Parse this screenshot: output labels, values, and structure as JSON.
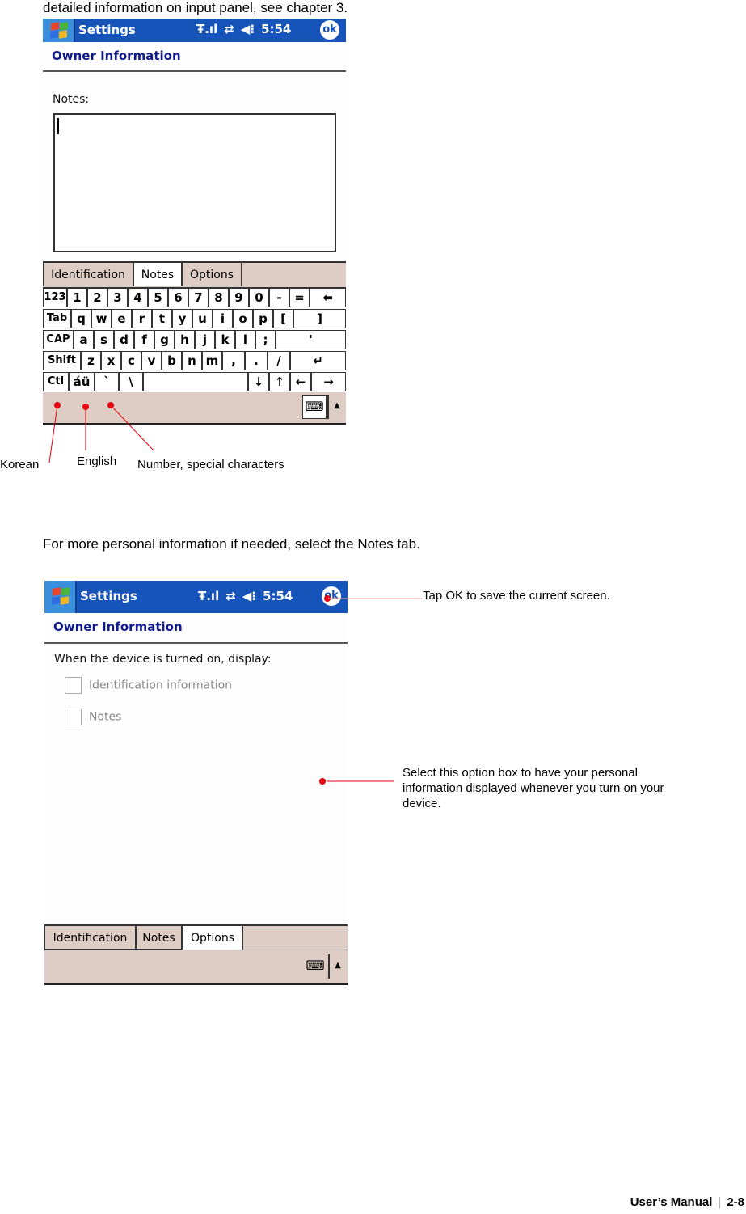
{
  "doc": {
    "intro_line": "detailed information on input panel, see chapter 3.",
    "notes_tab_instruction": "For more personal information if needed, select the Notes tab.",
    "footer_title": "User’s Manual",
    "footer_page": "2-8"
  },
  "colors": {
    "titlebar": "#1654b9",
    "subheader_text": "#0f1a8c",
    "tab_bg": "#ddcdc4",
    "callout_red": "#e8000c"
  },
  "screen1": {
    "title": "Settings",
    "status": {
      "signal_icon": "signal-icon",
      "sync_icon": "connectivity-icon",
      "volume_icon": "speaker-icon",
      "time": "5:54",
      "ok_label": "ok"
    },
    "header": "Owner Information",
    "notes_label": "Notes:",
    "notes_value": "",
    "tabs": [
      {
        "label": "Identification",
        "active": false
      },
      {
        "label": "Notes",
        "active": true
      },
      {
        "label": "Options",
        "active": false
      }
    ],
    "keyboard": {
      "rows": [
        [
          "123",
          "1",
          "2",
          "3",
          "4",
          "5",
          "6",
          "7",
          "8",
          "9",
          "0",
          "-",
          "=",
          "⬅"
        ],
        [
          "Tab",
          "q",
          "w",
          "e",
          "r",
          "t",
          "y",
          "u",
          "i",
          "o",
          "p",
          "[",
          "]"
        ],
        [
          "CAP",
          "a",
          "s",
          "d",
          "f",
          "g",
          "h",
          "j",
          "k",
          "l",
          ";",
          "'"
        ],
        [
          "Shift",
          "z",
          "x",
          "c",
          "v",
          "b",
          "n",
          "m",
          ",",
          ".",
          "/",
          "↵"
        ],
        [
          "Ctl",
          "áü",
          "`",
          "\\",
          " ",
          "↓",
          "↑",
          "←",
          "→"
        ]
      ]
    },
    "sip": {
      "keyboard_icon": "⌨",
      "arrow_icon": "▲"
    },
    "callouts": [
      "Korean",
      "English",
      "Number, special characters"
    ]
  },
  "screen2": {
    "title": "Settings",
    "status": {
      "time": "5:54",
      "ok_label": "ok"
    },
    "header": "Owner Information",
    "display_label": "When the device is turned on, display:",
    "options": [
      {
        "label": "Identification information",
        "checked": false
      },
      {
        "label": "Notes",
        "checked": false
      }
    ],
    "tabs": [
      {
        "label": "Identification",
        "active": false
      },
      {
        "label": "Notes",
        "active": false
      },
      {
        "label": "Options",
        "active": true
      }
    ],
    "sip": {
      "keyboard_icon": "⌨",
      "arrow_icon": "▲"
    },
    "callouts": [
      "Tap OK to save the current screen.",
      "Select this option box to have your personal information displayed whenever you turn on your device."
    ]
  }
}
